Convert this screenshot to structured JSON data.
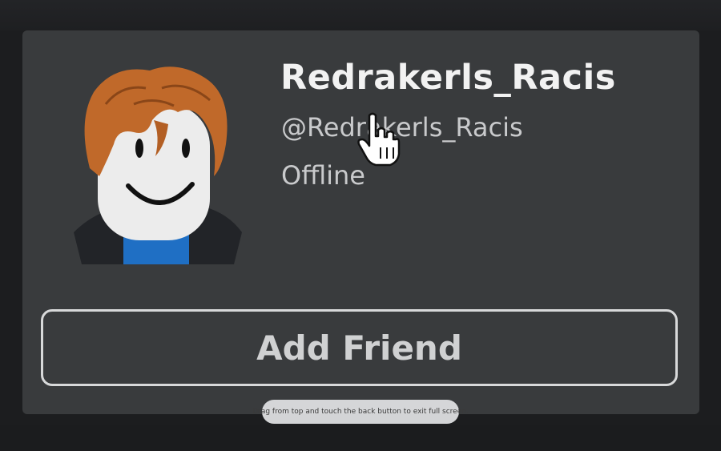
{
  "profile": {
    "display_name": "Redrakerls_Racis",
    "username": "@Redrakerls_Racis",
    "status": "Offline"
  },
  "actions": {
    "add_friend_label": "Add Friend"
  },
  "system_toast": {
    "message": "Drag from top and touch the back button to exit full screen."
  },
  "colors": {
    "card_background": "#393b3d",
    "page_background": "#1c1d1f",
    "hair": "#c0692a",
    "face": "#ececec",
    "shirt": "#1f6fc4"
  },
  "icons": {
    "cursor": "hand-pointer-icon"
  }
}
